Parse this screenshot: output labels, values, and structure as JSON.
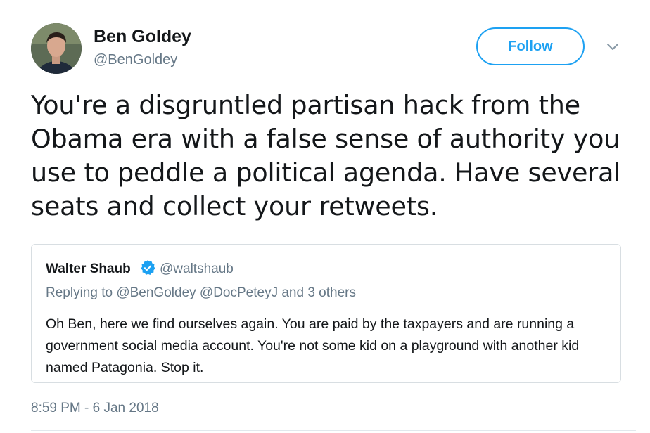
{
  "author": {
    "name": "Ben Goldey",
    "handle": "@BenGoldey"
  },
  "follow_button": {
    "label": "Follow"
  },
  "tweet": {
    "text": "You're a disgruntled partisan hack from the Obama era with a false sense of authority you use to peddle a political agenda. Have several seats and collect your retweets.",
    "timestamp": "8:59 PM - 6 Jan 2018"
  },
  "quoted_tweet": {
    "name": "Walter Shaub",
    "handle": "@waltshaub",
    "replying_to": "Replying to @BenGoldey @DocPeteyJ and 3 others",
    "text": "Oh Ben, here we find ourselves again. You are paid by the taxpayers and are running a government social media account. You're not some kid on a playground with another kid named Patagonia. Stop it."
  },
  "icons": {
    "caret": "chevron-down-icon",
    "verified": "verified-badge-icon",
    "avatar": "avatar"
  },
  "colors": {
    "accent": "#1da1f2",
    "text": "#14171a",
    "secondary_text": "#657786",
    "border": "#d8dee2"
  }
}
